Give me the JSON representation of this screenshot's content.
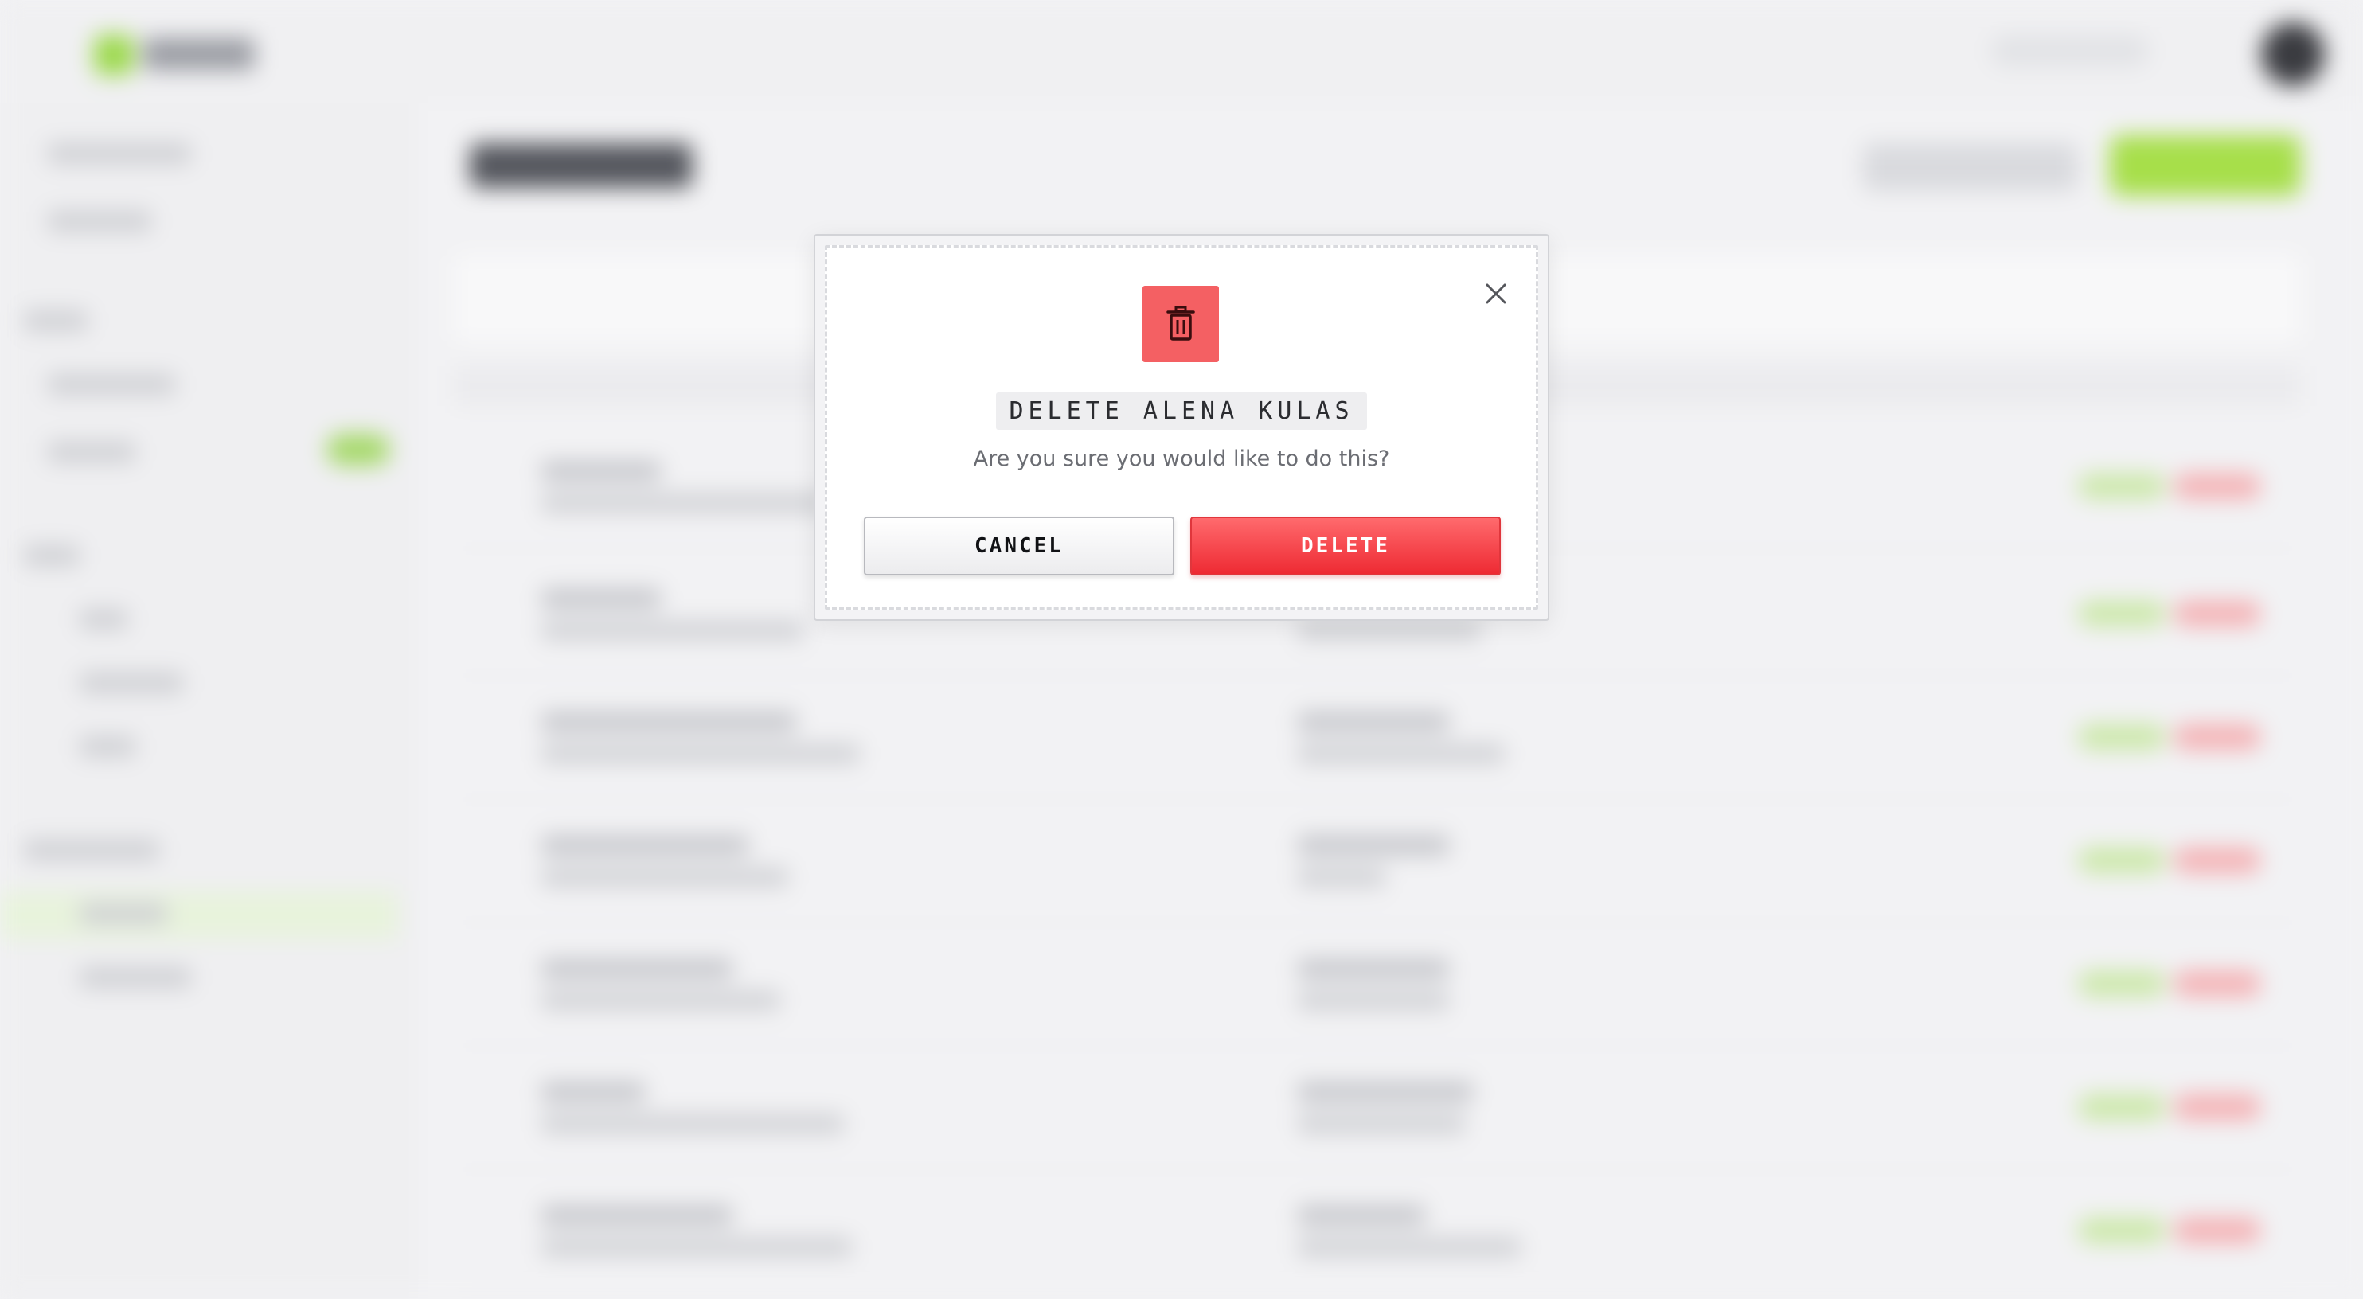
{
  "dialog": {
    "title": "DELETE ALENA KULAS",
    "message": "Are you sure you would like to do this?",
    "cancel_label": "CANCEL",
    "delete_label": "DELETE",
    "icon": "trash-icon",
    "close_icon": "close-icon"
  },
  "colors": {
    "danger": "#f46063",
    "danger_button": "#ee2a33",
    "accent_green": "#a7df4a"
  }
}
